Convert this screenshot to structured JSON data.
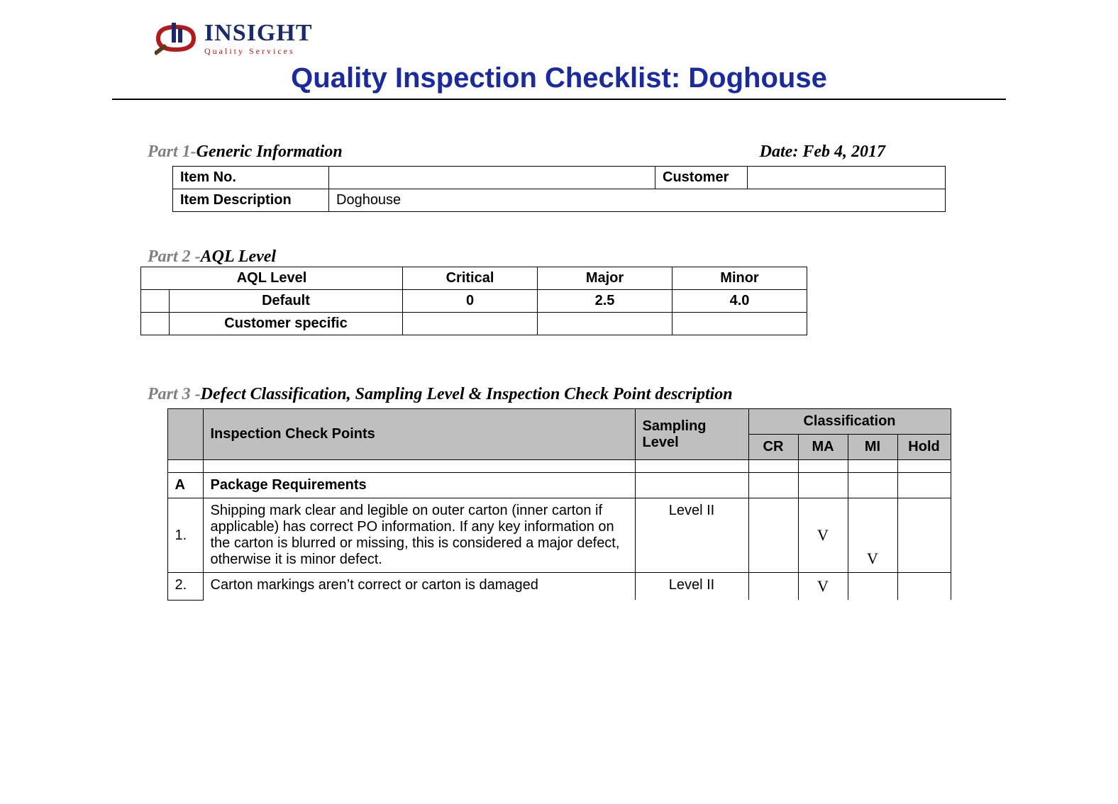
{
  "logo": {
    "word": "INSIGHT",
    "sub": "Quality Services"
  },
  "title": "Quality Inspection Checklist: Doghouse",
  "part1": {
    "heading_prefix": "Part 1-",
    "heading_title": "Generic Information",
    "date_prefix": "Date: ",
    "date_value": "Feb 4, 2017",
    "item_no_label": "Item No.",
    "item_no_value": "",
    "customer_label": "Customer",
    "customer_value": "",
    "item_desc_label": "Item Description",
    "item_desc_value": "Doghouse"
  },
  "part2": {
    "heading_prefix": "Part 2 -",
    "heading_title": "AQL Level",
    "headers": {
      "aql": "AQL Level",
      "critical": "Critical",
      "major": "Major",
      "minor": "Minor"
    },
    "rows": [
      {
        "label": "Default",
        "critical": "0",
        "major": "2.5",
        "minor": "4.0"
      },
      {
        "label": "Customer specific",
        "critical": "",
        "major": "",
        "minor": ""
      }
    ]
  },
  "part3": {
    "heading_prefix": "Part 3 -",
    "heading_title": "Defect Classification, Sampling Level & Inspection Check Point description",
    "headers": {
      "checkpoints": "Inspection Check Points",
      "sampling": "Sampling Level",
      "classification": "Classification",
      "cr": "CR",
      "ma": "MA",
      "mi": "MI",
      "hold": "Hold"
    },
    "section_a": {
      "id": "A",
      "title": "Package Requirements"
    },
    "rows": [
      {
        "num": "1.",
        "desc": "Shipping mark clear and legible on outer carton (inner carton if applicable) has correct PO information. If any key information on the carton is blurred or missing, this is considered a major defect, otherwise it is minor defect.",
        "sampling": "Level II",
        "cr": "",
        "ma": "V",
        "mi": "V",
        "hold": ""
      },
      {
        "num": "2.",
        "desc": "Carton markings aren’t correct or carton is damaged",
        "sampling": "Level II",
        "cr": "",
        "ma": "V",
        "mi": "",
        "hold": ""
      }
    ]
  }
}
